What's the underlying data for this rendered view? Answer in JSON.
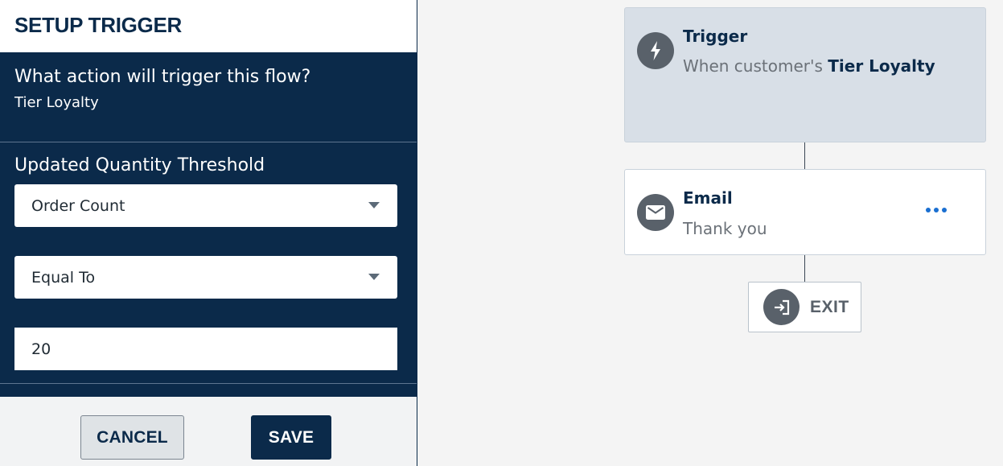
{
  "setup": {
    "title": "SETUP TRIGGER",
    "question_label": "What action will trigger this flow?",
    "question_value": "Tier Loyalty",
    "threshold_label": "Updated Quantity Threshold",
    "metric_select": "Order Count",
    "operator_select": "Equal To",
    "threshold_value": "20",
    "cancel_label": "CANCEL",
    "save_label": "SAVE"
  },
  "flow": {
    "trigger": {
      "title": "Trigger",
      "description_prefix": "When customer's ",
      "description_highlight": "Tier Loyalty",
      "icon": "lightning-icon"
    },
    "email": {
      "title": "Email",
      "subtitle": "Thank you",
      "icon": "envelope-icon",
      "menu_icon": "more-horizontal-icon"
    },
    "exit": {
      "label": "EXIT",
      "icon": "exit-icon"
    }
  },
  "colors": {
    "navy": "#0b2a4a",
    "trigger_bg": "#d8dfe7",
    "icon_circle": "#59616a",
    "link_blue": "#1a6fd1"
  }
}
